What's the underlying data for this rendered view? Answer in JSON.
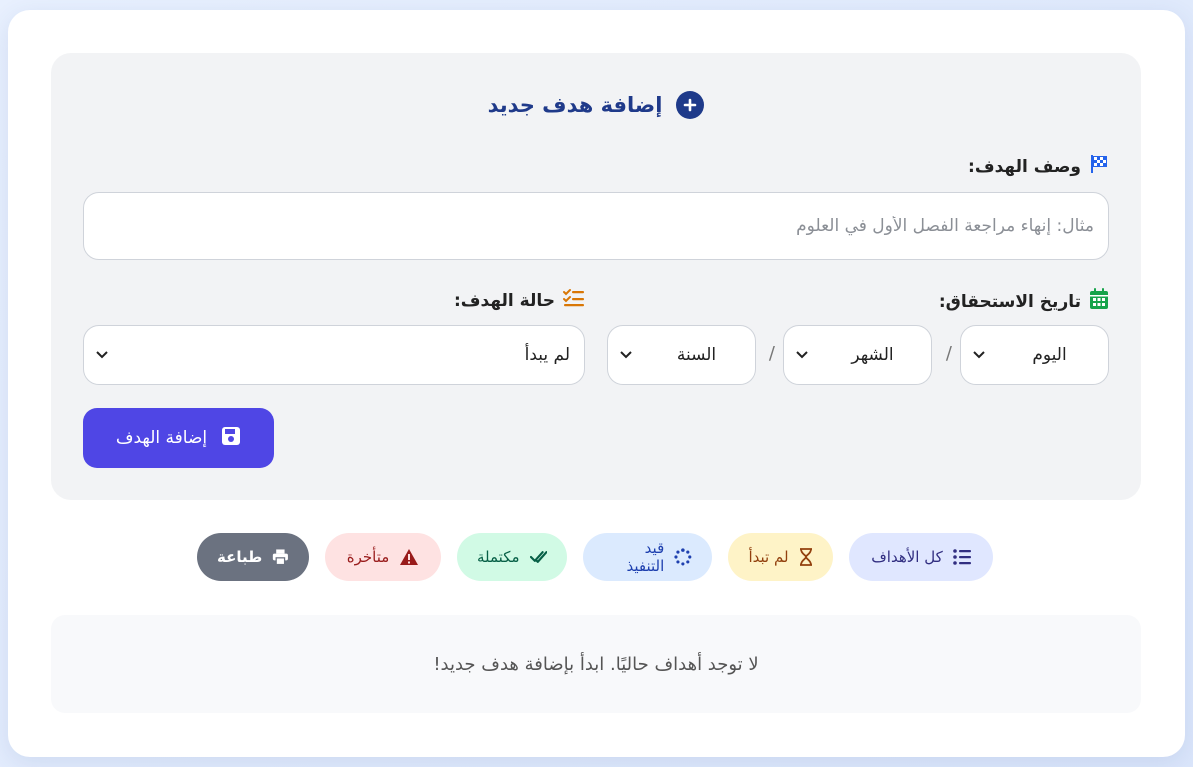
{
  "form": {
    "title": "إضافة هدف جديد",
    "description_label": "وصف الهدف:",
    "description_placeholder": "مثال: إنهاء مراجعة الفصل الأول في العلوم",
    "description_value": "",
    "due_date_label": "تاريخ الاستحقاق:",
    "status_label": "حالة الهدف:",
    "day_value": "اليوم",
    "month_value": "الشهر",
    "year_value": "السنة",
    "date_separator": "/",
    "status_value": "لم يبدأ",
    "submit_label": "إضافة الهدف"
  },
  "filters": [
    {
      "label": "كل الأهداف",
      "icon": "list-icon"
    },
    {
      "label": "لم تبدأ",
      "icon": "hourglass-icon"
    },
    {
      "label": "قيد التنفيذ",
      "icon": "spinner-icon"
    },
    {
      "label": "مكتملة",
      "icon": "double-check-icon"
    },
    {
      "label": "متأخرة",
      "icon": "warning-icon"
    },
    {
      "label": "طباعة",
      "icon": "printer-icon"
    }
  ],
  "empty_message": "لا توجد أهداف حاليًا. ابدأ بإضافة هدف جديد!",
  "colors": {
    "accent": "#4f46e5",
    "title": "#1f3a8a",
    "flag_icon": "#2563eb",
    "calendar_icon": "#16a34a",
    "status_icon": "#d97706"
  }
}
